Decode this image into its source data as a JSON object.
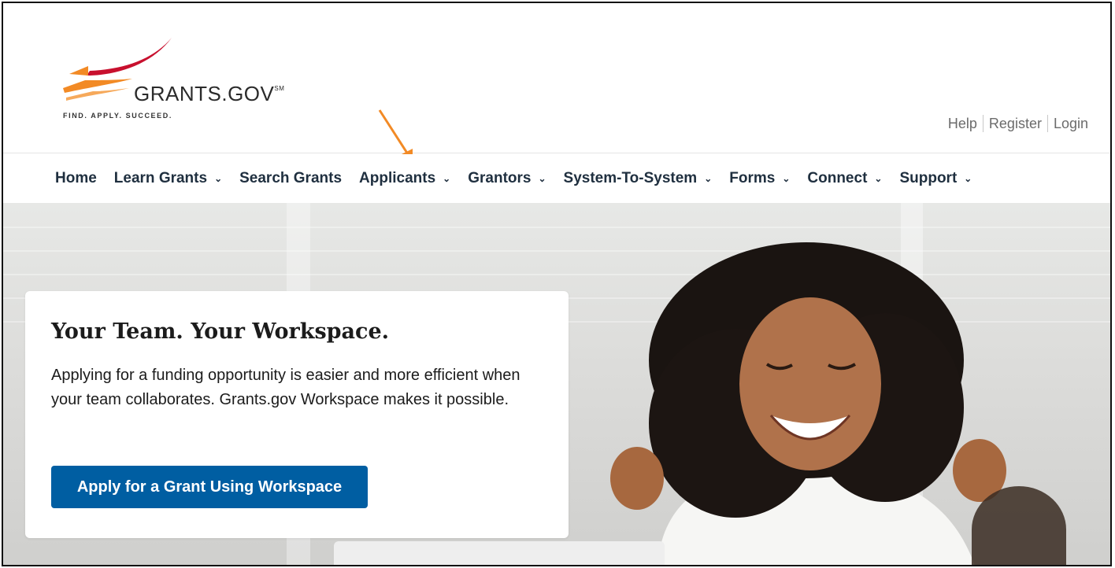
{
  "brand": {
    "name": "GRANTS.GOV",
    "mark": "SM",
    "tagline": "FIND. APPLY. SUCCEED.",
    "colors": {
      "red": "#c8102e",
      "orange": "#f28a25"
    }
  },
  "utility_links": [
    "Help",
    "Register",
    "Login"
  ],
  "nav": {
    "items": [
      {
        "label": "Home",
        "dropdown": false
      },
      {
        "label": "Learn Grants",
        "dropdown": true
      },
      {
        "label": "Search Grants",
        "dropdown": false
      },
      {
        "label": "Applicants",
        "dropdown": true
      },
      {
        "label": "Grantors",
        "dropdown": true
      },
      {
        "label": "System-To-System",
        "dropdown": true
      },
      {
        "label": "Forms",
        "dropdown": true
      },
      {
        "label": "Connect",
        "dropdown": true
      },
      {
        "label": "Support",
        "dropdown": true
      }
    ],
    "chevron_glyph": "⌄"
  },
  "annotation": {
    "color": "#f28a25",
    "target": "Applicants"
  },
  "hero": {
    "title": "Your Team. Your Workspace.",
    "body": "Applying for a funding opportunity is easier and more efficient when your team collaborates. Grants.gov Workspace makes it possible.",
    "cta_label": "Apply for a Grant Using Workspace",
    "cta_color": "#005ea2"
  }
}
